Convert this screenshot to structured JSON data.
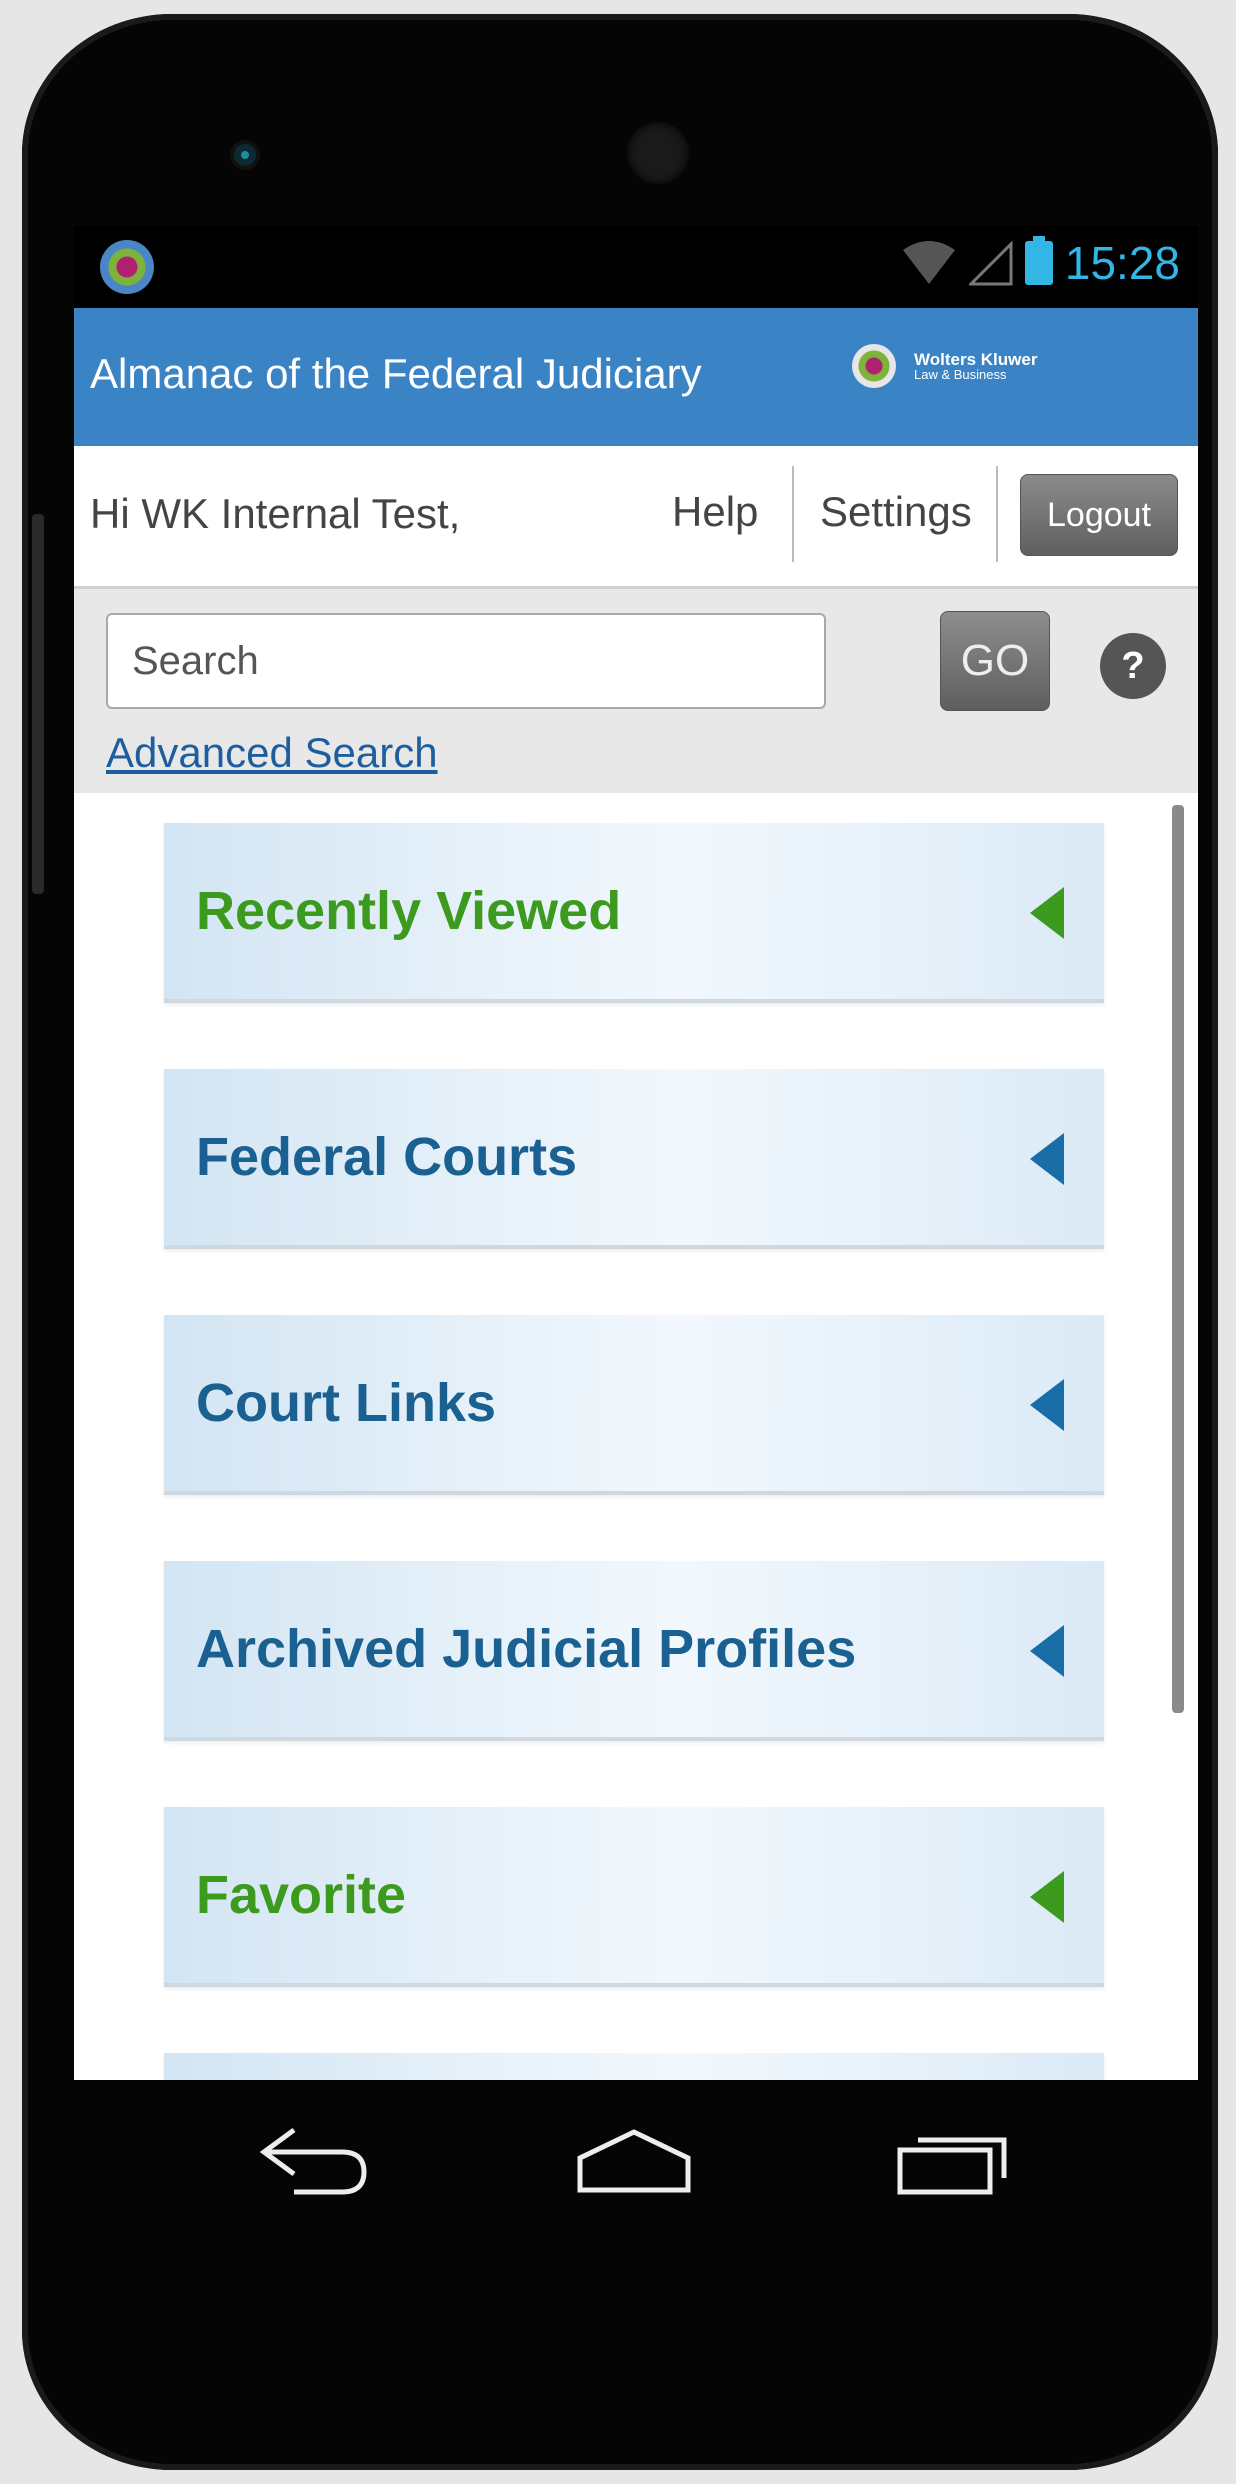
{
  "status_bar": {
    "time": "15:28"
  },
  "app_bar": {
    "title": "Almanac of the Federal Judiciary",
    "brand_line1": "Wolters Kluwer",
    "brand_line2": "Law & Business"
  },
  "user_bar": {
    "greeting": "Hi WK Internal Test,",
    "help_label": "Help",
    "settings_label": "Settings",
    "logout_label": "Logout"
  },
  "search": {
    "placeholder": "Search",
    "go_label": "GO",
    "help_icon": "?",
    "advanced_label": "Advanced Search"
  },
  "menu": {
    "items": [
      {
        "label": "Recently Viewed",
        "color": "#3c9a1e"
      },
      {
        "label": "Federal Courts",
        "color": "#1a6090"
      },
      {
        "label": "Court Links",
        "color": "#1a6090"
      },
      {
        "label": "Archived Judicial Profiles",
        "color": "#1a6090"
      },
      {
        "label": "Favorite",
        "color": "#3c9a1e"
      }
    ]
  },
  "colors": {
    "app_bar": "#3a84c6",
    "accent_green": "#3c9a1e",
    "accent_blue": "#1a6090",
    "status_blue": "#33b5e5"
  },
  "icons": [
    "app-flower-icon",
    "wifi-icon",
    "signal-icon",
    "battery-icon",
    "help-circle-icon",
    "collapse-arrow-icon",
    "back-icon",
    "home-icon",
    "recent-apps-icon"
  ]
}
